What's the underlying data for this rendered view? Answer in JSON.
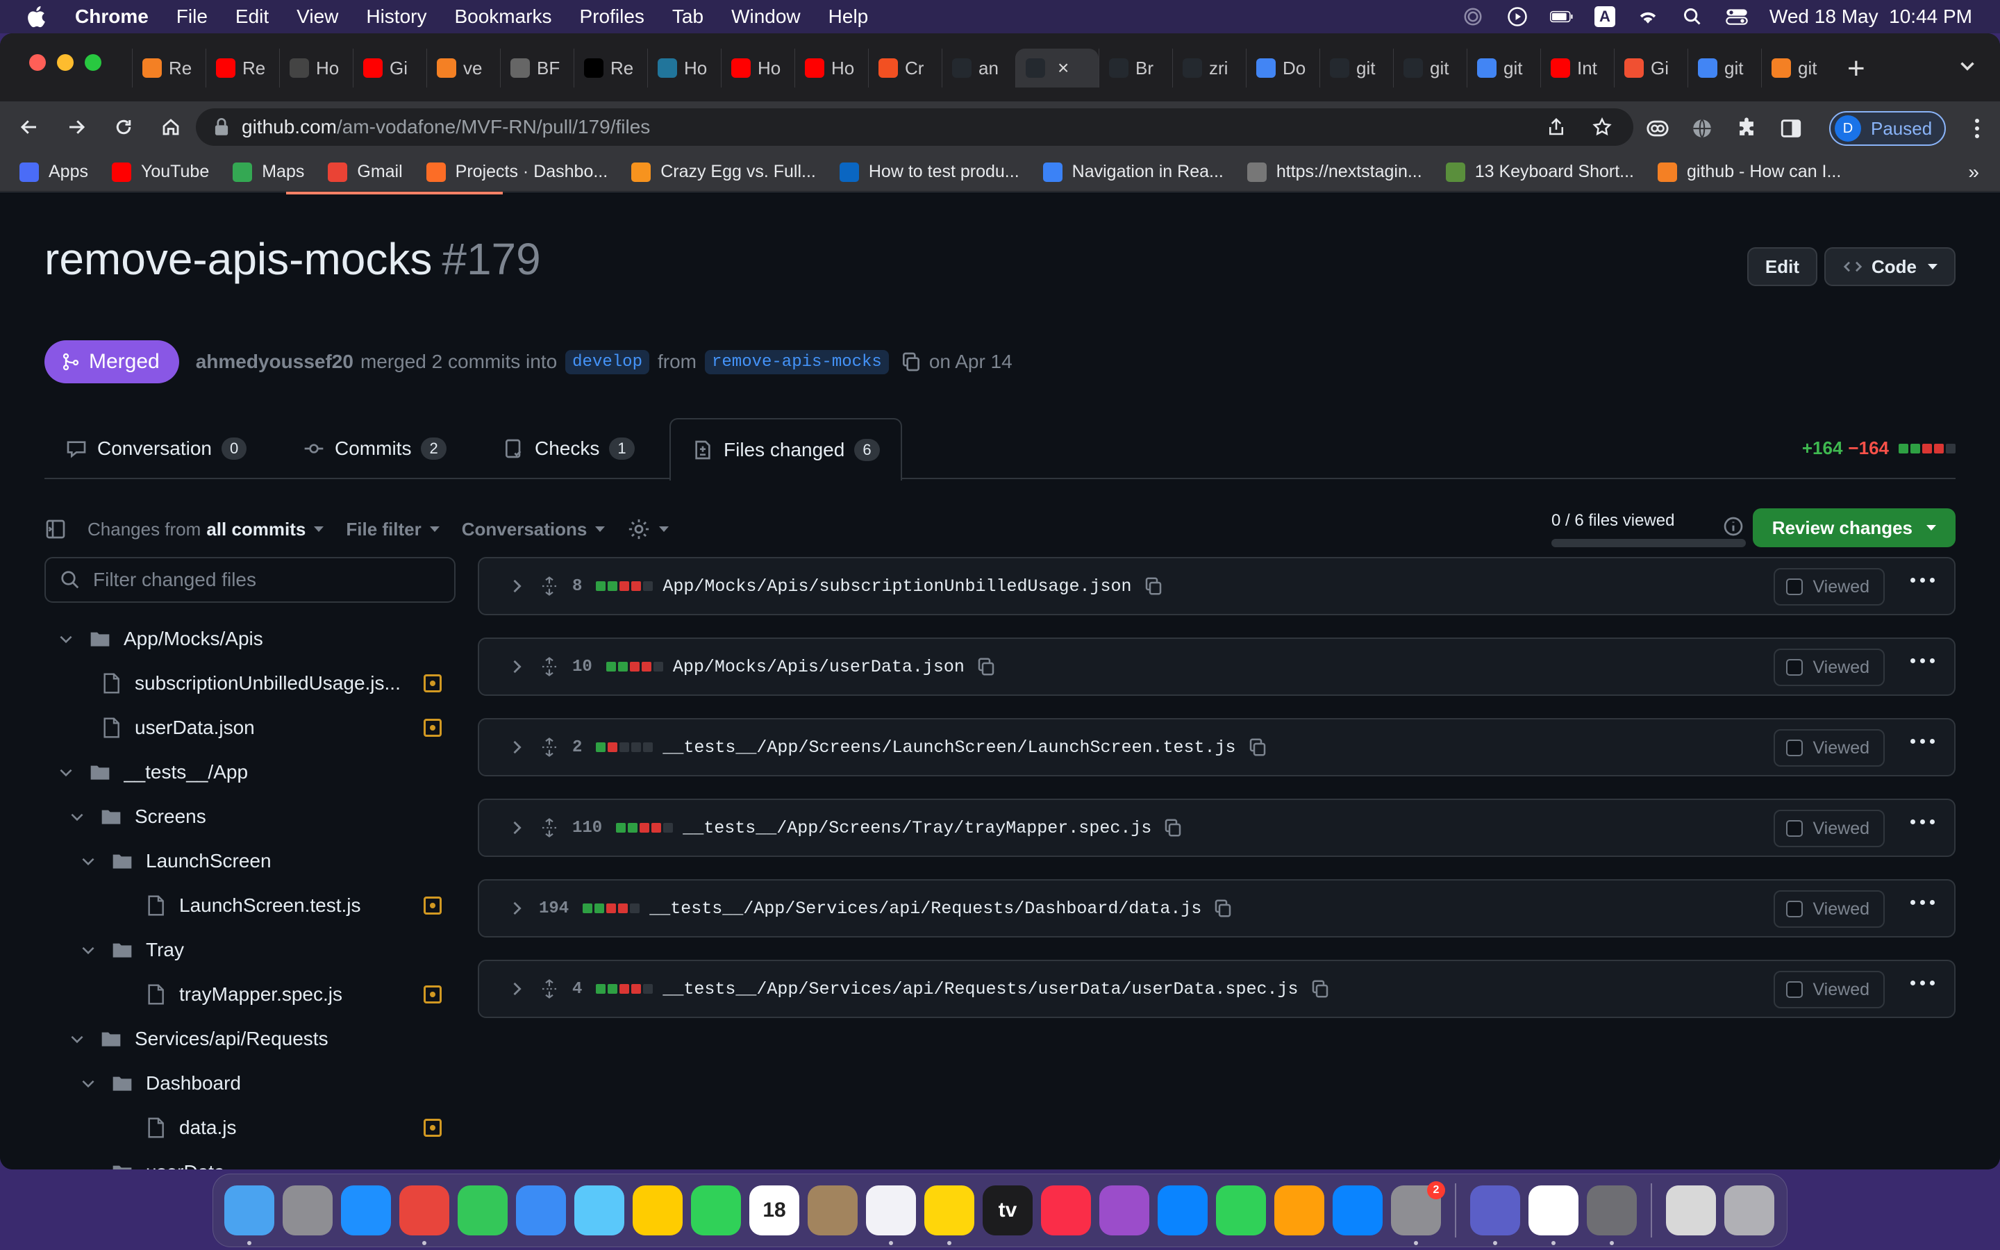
{
  "menubar": {
    "app_name": "Chrome",
    "items": [
      "File",
      "Edit",
      "View",
      "History",
      "Bookmarks",
      "Profiles",
      "Tab",
      "Window",
      "Help"
    ],
    "input_badge": "A",
    "datetime": "Wed 18 May  10:44 PM"
  },
  "browser": {
    "tabs": [
      {
        "label": "Re",
        "icon": "stackoverflow-icon",
        "color": "#f48024"
      },
      {
        "label": "Re",
        "icon": "youtube-icon",
        "color": "#ff0000"
      },
      {
        "label": "Ho",
        "icon": "code-icon",
        "color": "#444"
      },
      {
        "label": "Gi",
        "icon": "youtube-icon",
        "color": "#ff0000"
      },
      {
        "label": "ve",
        "icon": "stackoverflow-icon",
        "color": "#f48024"
      },
      {
        "label": "BF",
        "icon": "globe-icon",
        "color": "#666"
      },
      {
        "label": "Re",
        "icon": "dev-icon",
        "color": "#000"
      },
      {
        "label": "Ho",
        "icon": "wordpress-icon",
        "color": "#21759b"
      },
      {
        "label": "Ho",
        "icon": "youtube-icon",
        "color": "#ff0000"
      },
      {
        "label": "Ho",
        "icon": "youtube-icon",
        "color": "#ff0000"
      },
      {
        "label": "Cr",
        "icon": "microsoft-icon",
        "color": "#f25022"
      },
      {
        "label": "an",
        "icon": "github-icon",
        "color": "#24292f"
      },
      {
        "label": "",
        "icon": "github-icon",
        "color": "#24292f",
        "active": true
      },
      {
        "label": "Br",
        "icon": "github-icon",
        "color": "#24292f"
      },
      {
        "label": "zri",
        "icon": "github-icon",
        "color": "#24292f"
      },
      {
        "label": "Do",
        "icon": "doc-icon",
        "color": "#4285f4"
      },
      {
        "label": "git",
        "icon": "github-icon",
        "color": "#24292f"
      },
      {
        "label": "git",
        "icon": "github-icon",
        "color": "#24292f"
      },
      {
        "label": "git",
        "icon": "google-icon",
        "color": "#4285f4"
      },
      {
        "label": "Int",
        "icon": "youtube-icon",
        "color": "#ff0000"
      },
      {
        "label": "Gi",
        "icon": "git-icon",
        "color": "#f05032"
      },
      {
        "label": "git",
        "icon": "google-icon",
        "color": "#4285f4"
      },
      {
        "label": "git",
        "icon": "stackoverflow-icon",
        "color": "#f48024"
      }
    ],
    "url_host": "github.com",
    "url_path": "/am-vodafone/MVF-RN/pull/179/files",
    "profile_initial": "D",
    "profile_status": "Paused",
    "bookmarks": [
      {
        "label": "Apps",
        "icon": "apps-grid-icon",
        "color": "#4a6cf7"
      },
      {
        "label": "YouTube",
        "icon": "youtube-icon",
        "color": "#ff0000"
      },
      {
        "label": "Maps",
        "icon": "maps-icon",
        "color": "#34a853"
      },
      {
        "label": "Gmail",
        "icon": "gmail-icon",
        "color": "#ea4335"
      },
      {
        "label": "Projects · Dashbo...",
        "icon": "gitlab-icon",
        "color": "#fc6d26"
      },
      {
        "label": "Crazy Egg vs. Full...",
        "icon": "crazyegg-icon",
        "color": "#f7931e"
      },
      {
        "label": "How to test produ...",
        "icon": "linkedin-icon",
        "color": "#0a66c2"
      },
      {
        "label": "Navigation in Rea...",
        "icon": "cd-icon",
        "color": "#3b82f6"
      },
      {
        "label": "https://nextstagin...",
        "icon": "globe-icon",
        "color": "#777"
      },
      {
        "label": "13 Keyboard Short...",
        "icon": "gear-icon",
        "color": "#5a8f3c"
      },
      {
        "label": "github - How can I...",
        "icon": "stackoverflow-icon",
        "color": "#f48024"
      }
    ],
    "more": "»"
  },
  "pr": {
    "title": "remove-apis-mocks",
    "number": "#179",
    "edit_label": "Edit",
    "code_label": "Code",
    "status": "Merged",
    "author": "ahmedyoussef20",
    "merged_text": "merged 2 commits into",
    "base_branch": "develop",
    "from_text": "from",
    "head_branch": "remove-apis-mocks",
    "date_text": "on Apr 14"
  },
  "tabs": [
    {
      "label": "Conversation",
      "count": "0"
    },
    {
      "label": "Commits",
      "count": "2"
    },
    {
      "label": "Checks",
      "count": "1"
    },
    {
      "label": "Files changed",
      "count": "6"
    }
  ],
  "diffstat": {
    "additions": "+164",
    "deletions": "−164"
  },
  "filebar": {
    "changes_from": "Changes from",
    "all_commits": "all commits",
    "file_filter": "File filter",
    "conversations": "Conversations",
    "viewed_progress": "0 / 6 files viewed",
    "viewed_fraction": 0,
    "review_label": "Review changes"
  },
  "filter": {
    "placeholder": "Filter changed files"
  },
  "tree": [
    {
      "name": "App/Mocks/Apis",
      "type": "folder",
      "depth": 0
    },
    {
      "name": "subscriptionUnbilledUsage.js...",
      "type": "file",
      "depth": 1,
      "modified": true
    },
    {
      "name": "userData.json",
      "type": "file",
      "depth": 1,
      "modified": true
    },
    {
      "name": "__tests__/App",
      "type": "folder",
      "depth": 0
    },
    {
      "name": "Screens",
      "type": "folder",
      "depth": 1
    },
    {
      "name": "LaunchScreen",
      "type": "folder",
      "depth": 2
    },
    {
      "name": "LaunchScreen.test.js",
      "type": "file",
      "depth": 3,
      "modified": true
    },
    {
      "name": "Tray",
      "type": "folder",
      "depth": 2
    },
    {
      "name": "trayMapper.spec.js",
      "type": "file",
      "depth": 3,
      "modified": true
    },
    {
      "name": "Services/api/Requests",
      "type": "folder",
      "depth": 1
    },
    {
      "name": "Dashboard",
      "type": "folder",
      "depth": 2
    },
    {
      "name": "data.js",
      "type": "file",
      "depth": 3,
      "modified": true
    },
    {
      "name": "userData",
      "type": "folder",
      "depth": 2
    }
  ],
  "files": [
    {
      "count": "8",
      "path": "App/Mocks/Apis/subscriptionUnbilledUsage.json",
      "blocks": [
        "g",
        "g",
        "r",
        "r",
        "x"
      ],
      "viewed_label": "Viewed",
      "expandable": true
    },
    {
      "count": "10",
      "path": "App/Mocks/Apis/userData.json",
      "blocks": [
        "g",
        "g",
        "r",
        "r",
        "x"
      ],
      "viewed_label": "Viewed",
      "expandable": true
    },
    {
      "count": "2",
      "path": "__tests__/App/Screens/LaunchScreen/LaunchScreen.test.js",
      "blocks": [
        "g",
        "r",
        "x",
        "x",
        "x"
      ],
      "viewed_label": "Viewed",
      "expandable": true
    },
    {
      "count": "110",
      "path": "__tests__/App/Screens/Tray/trayMapper.spec.js",
      "blocks": [
        "g",
        "g",
        "r",
        "r",
        "x"
      ],
      "viewed_label": "Viewed",
      "expandable": true
    },
    {
      "count": "194",
      "path": "__tests__/App/Services/api/Requests/Dashboard/data.js",
      "blocks": [
        "g",
        "g",
        "r",
        "r",
        "x"
      ],
      "viewed_label": "Viewed",
      "expandable": false
    },
    {
      "count": "4",
      "path": "__tests__/App/Services/api/Requests/userData/userData.spec.js",
      "blocks": [
        "g",
        "g",
        "r",
        "r",
        "x"
      ],
      "viewed_label": "Viewed",
      "expandable": true
    }
  ],
  "dock": {
    "apps": [
      {
        "name": "finder-icon",
        "color": "#4aa3f0",
        "dot": true
      },
      {
        "name": "launchpad-icon",
        "color": "#8e8e93"
      },
      {
        "name": "safari-icon",
        "color": "#1e90ff"
      },
      {
        "name": "chrome-icon",
        "color": "#e8453c",
        "dot": true
      },
      {
        "name": "messages-icon",
        "color": "#34c759"
      },
      {
        "name": "mail-icon",
        "color": "#3b8cf5"
      },
      {
        "name": "maps-icon",
        "color": "#5ac8fa"
      },
      {
        "name": "photos-icon",
        "color": "#ffcc00"
      },
      {
        "name": "facetime-icon",
        "color": "#30d158"
      },
      {
        "name": "calendar-icon",
        "color": "#ffffff",
        "text": "18"
      },
      {
        "name": "contacts-icon",
        "color": "#a2845e"
      },
      {
        "name": "reminders-icon",
        "color": "#f2f2f7",
        "dot": true
      },
      {
        "name": "notes-icon",
        "color": "#ffd60a",
        "dot": true
      },
      {
        "name": "appletv-icon",
        "color": "#1c1c1e",
        "text": "tv"
      },
      {
        "name": "music-icon",
        "color": "#fa2d48"
      },
      {
        "name": "podcasts-icon",
        "color": "#9b4dca"
      },
      {
        "name": "keynote-icon",
        "color": "#0a84ff"
      },
      {
        "name": "numbers-icon",
        "color": "#30d158"
      },
      {
        "name": "pages-icon",
        "color": "#ff9f0a"
      },
      {
        "name": "appstore-icon",
        "color": "#0a84ff"
      },
      {
        "name": "system-preferences-icon",
        "color": "#8e8e93",
        "badge": "2",
        "dot": true
      },
      {
        "sep": true
      },
      {
        "name": "teams-icon",
        "color": "#5b5fc7",
        "dot": true
      },
      {
        "name": "slack-icon",
        "color": "#ffffff",
        "dot": true
      },
      {
        "name": "preview-icon",
        "color": "#6e6e73",
        "dot": true
      },
      {
        "sep": true
      },
      {
        "name": "coffee-icon",
        "color": "#d8d8d8"
      },
      {
        "name": "trash-icon",
        "color": "#b0b0b5"
      }
    ]
  }
}
